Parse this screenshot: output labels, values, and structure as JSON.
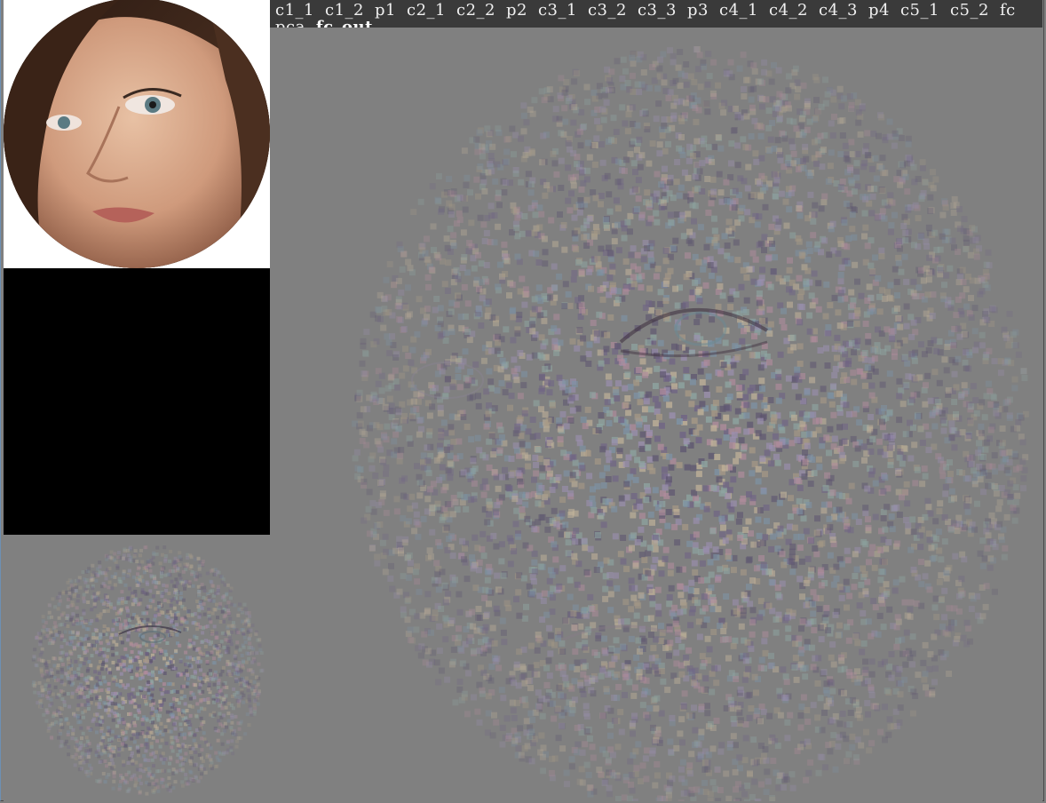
{
  "layers": [
    {
      "label": "c1_1",
      "active": false
    },
    {
      "label": "c1_2",
      "active": false
    },
    {
      "label": "p1",
      "active": false
    },
    {
      "label": "c2_1",
      "active": false
    },
    {
      "label": "c2_2",
      "active": false
    },
    {
      "label": "p2",
      "active": false
    },
    {
      "label": "c3_1",
      "active": false
    },
    {
      "label": "c3_2",
      "active": false
    },
    {
      "label": "c3_3",
      "active": false
    },
    {
      "label": "p3",
      "active": false
    },
    {
      "label": "c4_1",
      "active": false
    },
    {
      "label": "c4_2",
      "active": false
    },
    {
      "label": "c4_3",
      "active": false
    },
    {
      "label": "p4",
      "active": false
    },
    {
      "label": "c5_1",
      "active": false
    },
    {
      "label": "c5_2",
      "active": false
    },
    {
      "label": "fc",
      "active": false
    },
    {
      "label": "pca",
      "active": false
    },
    {
      "label": "fc_out",
      "active": true
    }
  ],
  "colors": {
    "bar_bg": "#3a3a3a",
    "canvas_gray": "#808080",
    "skin": "#d9a98a",
    "hair": "#4a2e1e",
    "lips": "#b5625a"
  }
}
